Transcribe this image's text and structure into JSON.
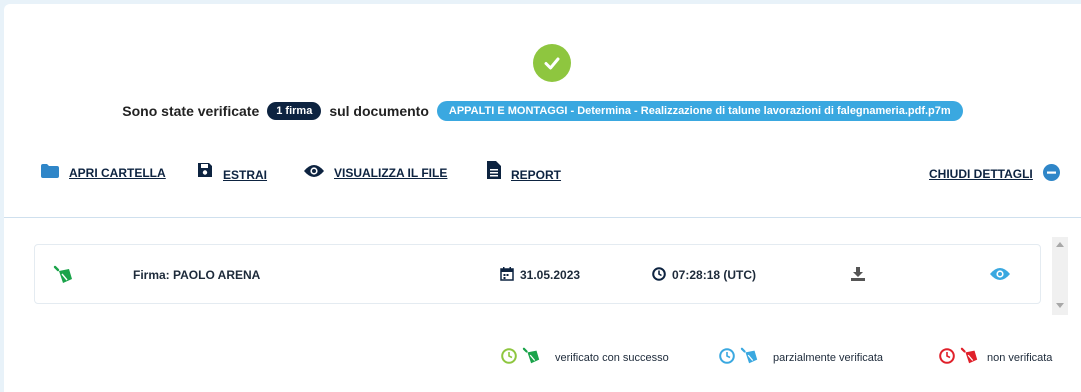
{
  "summary": {
    "prefix": "Sono state verificate",
    "count_badge": "1 firma",
    "middle": "sul documento",
    "document_name": "APPALTI E MONTAGGI - Determina - Realizzazione di talune lavorazioni di falegnameria.pdf.p7m"
  },
  "toolbar": {
    "open_folder": "APRI CARTELLA",
    "extract": "ESTRAI",
    "view_file": "VISUALIZZA IL FILE",
    "report": "REPORT",
    "close_details": "CHIUDI DETTAGLI"
  },
  "signatures": [
    {
      "label": "Firma: PAOLO ARENA",
      "date": "31.05.2023",
      "time": "07:28:18 (UTC)"
    }
  ],
  "legend": {
    "success": "verificato con successo",
    "partial": "parzialmente verificata",
    "failed": "non verificata"
  },
  "colors": {
    "success": "#8ec63f",
    "success_pen": "#1aa34a",
    "partial": "#3aa8e0",
    "failed": "#e0202a",
    "navy": "#0d2340"
  }
}
